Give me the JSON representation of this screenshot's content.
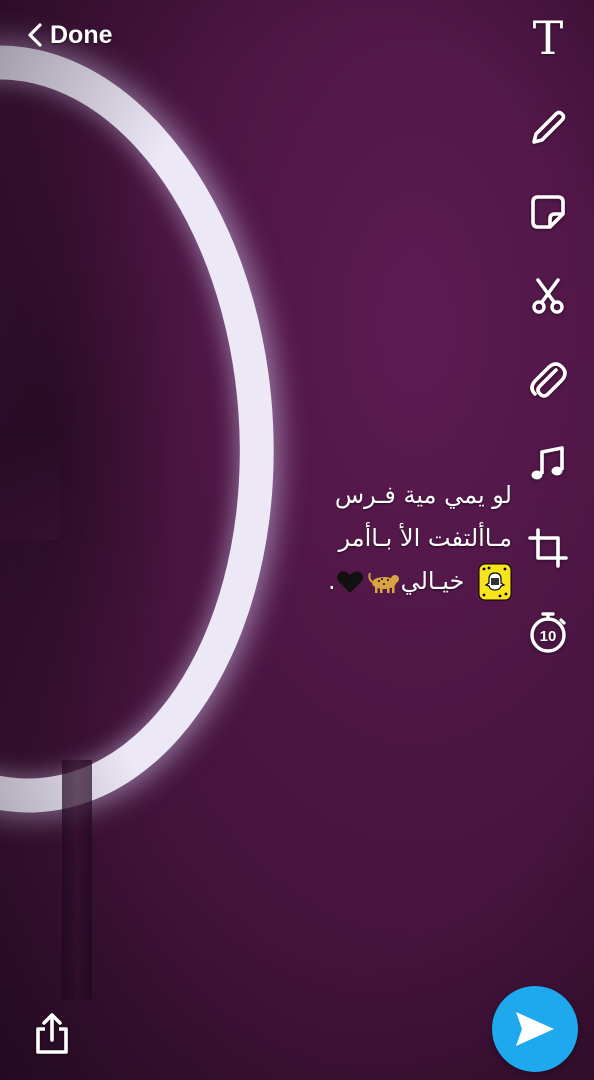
{
  "header": {
    "back_label": "Done"
  },
  "toolbar": {
    "tools": [
      {
        "name": "text-tool",
        "icon": "text-icon",
        "glyph": "T"
      },
      {
        "name": "draw-tool",
        "icon": "pencil-icon"
      },
      {
        "name": "sticker-tool",
        "icon": "sticker-icon"
      },
      {
        "name": "scissors-tool",
        "icon": "scissors-icon"
      },
      {
        "name": "attachment-tool",
        "icon": "paperclip-icon"
      },
      {
        "name": "music-tool",
        "icon": "music-note-icon"
      },
      {
        "name": "crop-tool",
        "icon": "crop-icon"
      },
      {
        "name": "timer-tool",
        "icon": "timer-icon",
        "value": "10"
      }
    ]
  },
  "caption": {
    "line1": "لو يمي مية فـرس",
    "line2": "مـاألتفت الأ بـاأمر",
    "line3": "خيـالي",
    "line3_suffix": ".",
    "emojis": [
      "snapcode-icon",
      "leopard-icon",
      "black-heart-icon"
    ]
  },
  "footer": {
    "share_icon": "share-icon",
    "send_icon": "send-arrow-icon"
  },
  "colors": {
    "background": "#4a1542",
    "ring_light": "#ede8f6",
    "send_button": "#1ea8ee",
    "icon": "#ffffff"
  }
}
